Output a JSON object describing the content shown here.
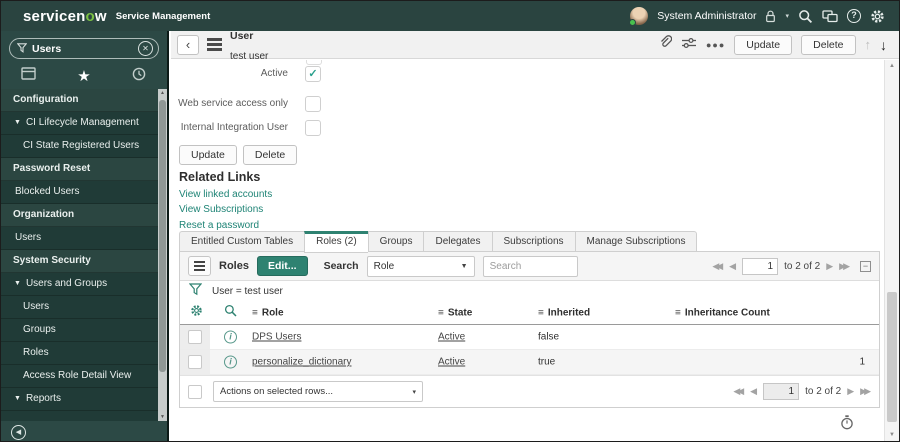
{
  "banner": {
    "logo_pre": "servicen",
    "logo_o": "o",
    "logo_post": "w",
    "app_name": "Service Management",
    "user_name": "System Administrator"
  },
  "sidebar": {
    "search_value": "Users",
    "nav": [
      {
        "label": "Configuration",
        "type": "header"
      },
      {
        "label": "CI Lifecycle Management",
        "type": "expand"
      },
      {
        "label": "CI State Registered Users",
        "type": "subitem"
      },
      {
        "label": "Password Reset",
        "type": "header"
      },
      {
        "label": "Blocked Users",
        "type": "item"
      },
      {
        "label": "Organization",
        "type": "header"
      },
      {
        "label": "Users",
        "type": "item"
      },
      {
        "label": "System Security",
        "type": "header"
      },
      {
        "label": "Users and Groups",
        "type": "expand"
      },
      {
        "label": "Users",
        "type": "subitem"
      },
      {
        "label": "Groups",
        "type": "subitem"
      },
      {
        "label": "Roles",
        "type": "subitem"
      },
      {
        "label": "Access Role Detail View",
        "type": "subitem"
      },
      {
        "label": "Reports",
        "type": "expand"
      }
    ]
  },
  "record": {
    "title": "User",
    "subtitle": "test user",
    "update": "Update",
    "delete": "Delete"
  },
  "form": {
    "fields": [
      {
        "label": "Active",
        "mark": "✓"
      },
      {
        "label": "Web service access only",
        "mark": ""
      },
      {
        "label": "Internal Integration User",
        "mark": ""
      }
    ],
    "update": "Update",
    "delete": "Delete"
  },
  "related_links": {
    "title": "Related Links",
    "links": [
      "View linked accounts",
      "View Subscriptions",
      "Reset a password"
    ]
  },
  "tabs": {
    "items": [
      {
        "label": "Entitled Custom Tables",
        "active": false
      },
      {
        "label": "Roles (2)",
        "active": true
      },
      {
        "label": "Groups",
        "active": false
      },
      {
        "label": "Delegates",
        "active": false
      },
      {
        "label": "Subscriptions",
        "active": false
      },
      {
        "label": "Manage Subscriptions",
        "active": false
      }
    ]
  },
  "list": {
    "title": "Roles",
    "edit": "Edit...",
    "search_label": "Search",
    "search_column": "Role",
    "search_placeholder": "Search",
    "filter": "User = test user",
    "columns": [
      "Role",
      "State",
      "Inherited",
      "Inheritance Count"
    ],
    "rows": [
      {
        "role": "DPS Users",
        "state": "Active",
        "inherited": "false",
        "count": ""
      },
      {
        "role": "personalize_dictionary",
        "state": "Active",
        "inherited": "true",
        "count": "1"
      }
    ],
    "actions_placeholder": "Actions on selected rows...",
    "pagination": {
      "page": "1",
      "label": "to 2 of 2"
    }
  },
  "icons": {
    "caret_down": "▼",
    "select_caret": "▾",
    "user_caret": "▾",
    "star": "★",
    "close": "✕",
    "chevron_left": "‹",
    "more": "●●●",
    "arrow_up": "↑",
    "arrow_down": "↓",
    "menu": "≡",
    "info": "i",
    "help": "?",
    "first": "◀◀",
    "prev": "◀",
    "next": "▶",
    "last": "▶▶",
    "collapse": "−",
    "scroll_up": "▲",
    "scroll_down": "▼"
  },
  "colors": {
    "accent_teal": "#2e8271",
    "link_teal": "#1f8476",
    "banner_bg": "#2a4440",
    "nav_bg": "#203b37",
    "logo_green": "#7bc043"
  }
}
